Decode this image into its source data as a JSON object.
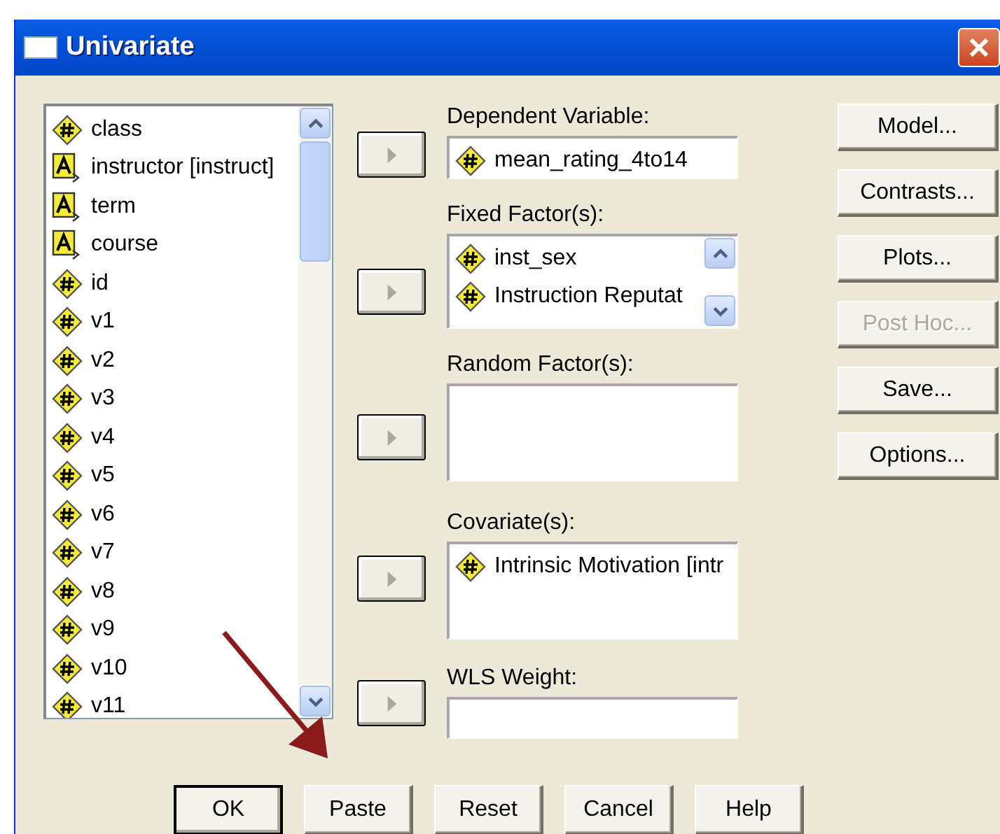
{
  "window": {
    "title": "Univariate"
  },
  "variables": [
    {
      "name": "class",
      "kind": "scale"
    },
    {
      "name": "instructor [instruct]",
      "kind": "string"
    },
    {
      "name": "term",
      "kind": "string"
    },
    {
      "name": "course",
      "kind": "string"
    },
    {
      "name": "id",
      "kind": "scale"
    },
    {
      "name": "v1",
      "kind": "scale"
    },
    {
      "name": "v2",
      "kind": "scale"
    },
    {
      "name": "v3",
      "kind": "scale"
    },
    {
      "name": "v4",
      "kind": "scale"
    },
    {
      "name": "v5",
      "kind": "scale"
    },
    {
      "name": "v6",
      "kind": "scale"
    },
    {
      "name": "v7",
      "kind": "scale"
    },
    {
      "name": "v8",
      "kind": "scale"
    },
    {
      "name": "v9",
      "kind": "scale"
    },
    {
      "name": "v10",
      "kind": "scale"
    },
    {
      "name": "v11",
      "kind": "scale"
    }
  ],
  "targets": [
    {
      "label": "Dependent Variable:",
      "kind": "single",
      "items": [
        {
          "name": "mean_rating_4to14",
          "kind": "scale"
        }
      ]
    },
    {
      "label": "Fixed Factor(s):",
      "kind": "list",
      "items": [
        {
          "name": "inst_sex",
          "kind": "scale"
        },
        {
          "name": "Instruction Reputat",
          "kind": "scale"
        }
      ]
    },
    {
      "label": "Random Factor(s):",
      "kind": "list"
    },
    {
      "label": "Covariate(s):",
      "kind": "list",
      "items": [
        {
          "name": "Intrinsic Motivation [intr",
          "kind": "scale"
        }
      ]
    },
    {
      "label": "WLS Weight:",
      "kind": "single"
    }
  ],
  "side_buttons": [
    {
      "label": "Model...",
      "disabled": false
    },
    {
      "label": "Contrasts...",
      "disabled": false
    },
    {
      "label": "Plots...",
      "disabled": false
    },
    {
      "label": "Post Hoc...",
      "disabled": true
    },
    {
      "label": "Save...",
      "disabled": false
    },
    {
      "label": "Options...",
      "disabled": false
    }
  ],
  "buttons": [
    {
      "label": "OK",
      "default": true
    },
    {
      "label": "Paste",
      "default": false
    },
    {
      "label": "Reset",
      "default": false
    },
    {
      "label": "Cancel",
      "default": false
    },
    {
      "label": "Help",
      "default": false
    }
  ]
}
